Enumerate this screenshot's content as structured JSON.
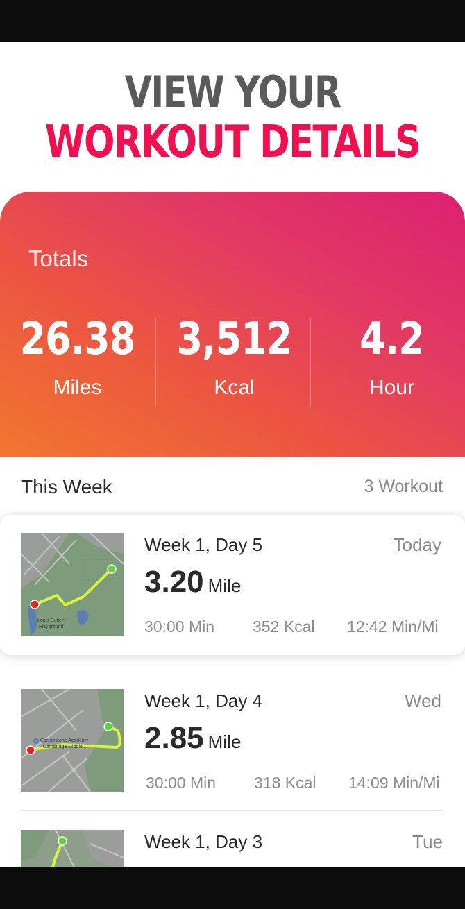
{
  "headline": {
    "line1": "VIEW YOUR",
    "line2": "WORKOUT DETAILS"
  },
  "totals": {
    "label": "Totals",
    "stats": [
      {
        "value": "26.38",
        "unit": "Miles"
      },
      {
        "value": "3,512",
        "unit": "Kcal"
      },
      {
        "value": "4.2",
        "unit": "Hour"
      }
    ]
  },
  "week": {
    "title": "This Week",
    "count": "3 Workout"
  },
  "workouts": [
    {
      "title": "Week 1, Day 5",
      "day": "Today",
      "distance": "3.20",
      "distance_unit": "Mile",
      "duration": "30:00 Min",
      "calories": "352 Kcal",
      "pace": "12:42 Min/Mi",
      "map_labels": [
        "Louis Sutter",
        "Playground"
      ]
    },
    {
      "title": "Week 1, Day 4",
      "day": "Wed",
      "distance": "2.85",
      "distance_unit": "Mile",
      "duration": "30:00 Min",
      "calories": "318 Kcal",
      "pace": "14:09 Min/Mi",
      "map_labels": [
        "Cornerstone Academy",
        "Cambridge Middle..."
      ]
    },
    {
      "title": "Week 1, Day 3",
      "day": "Tue"
    }
  ],
  "colors": {
    "accent": "#f0104f",
    "gradient_start": "#f2762f",
    "gradient_end": "#dc2072",
    "route": "#d6f53c",
    "start_marker": "#5ed338",
    "end_marker": "#e52222"
  }
}
